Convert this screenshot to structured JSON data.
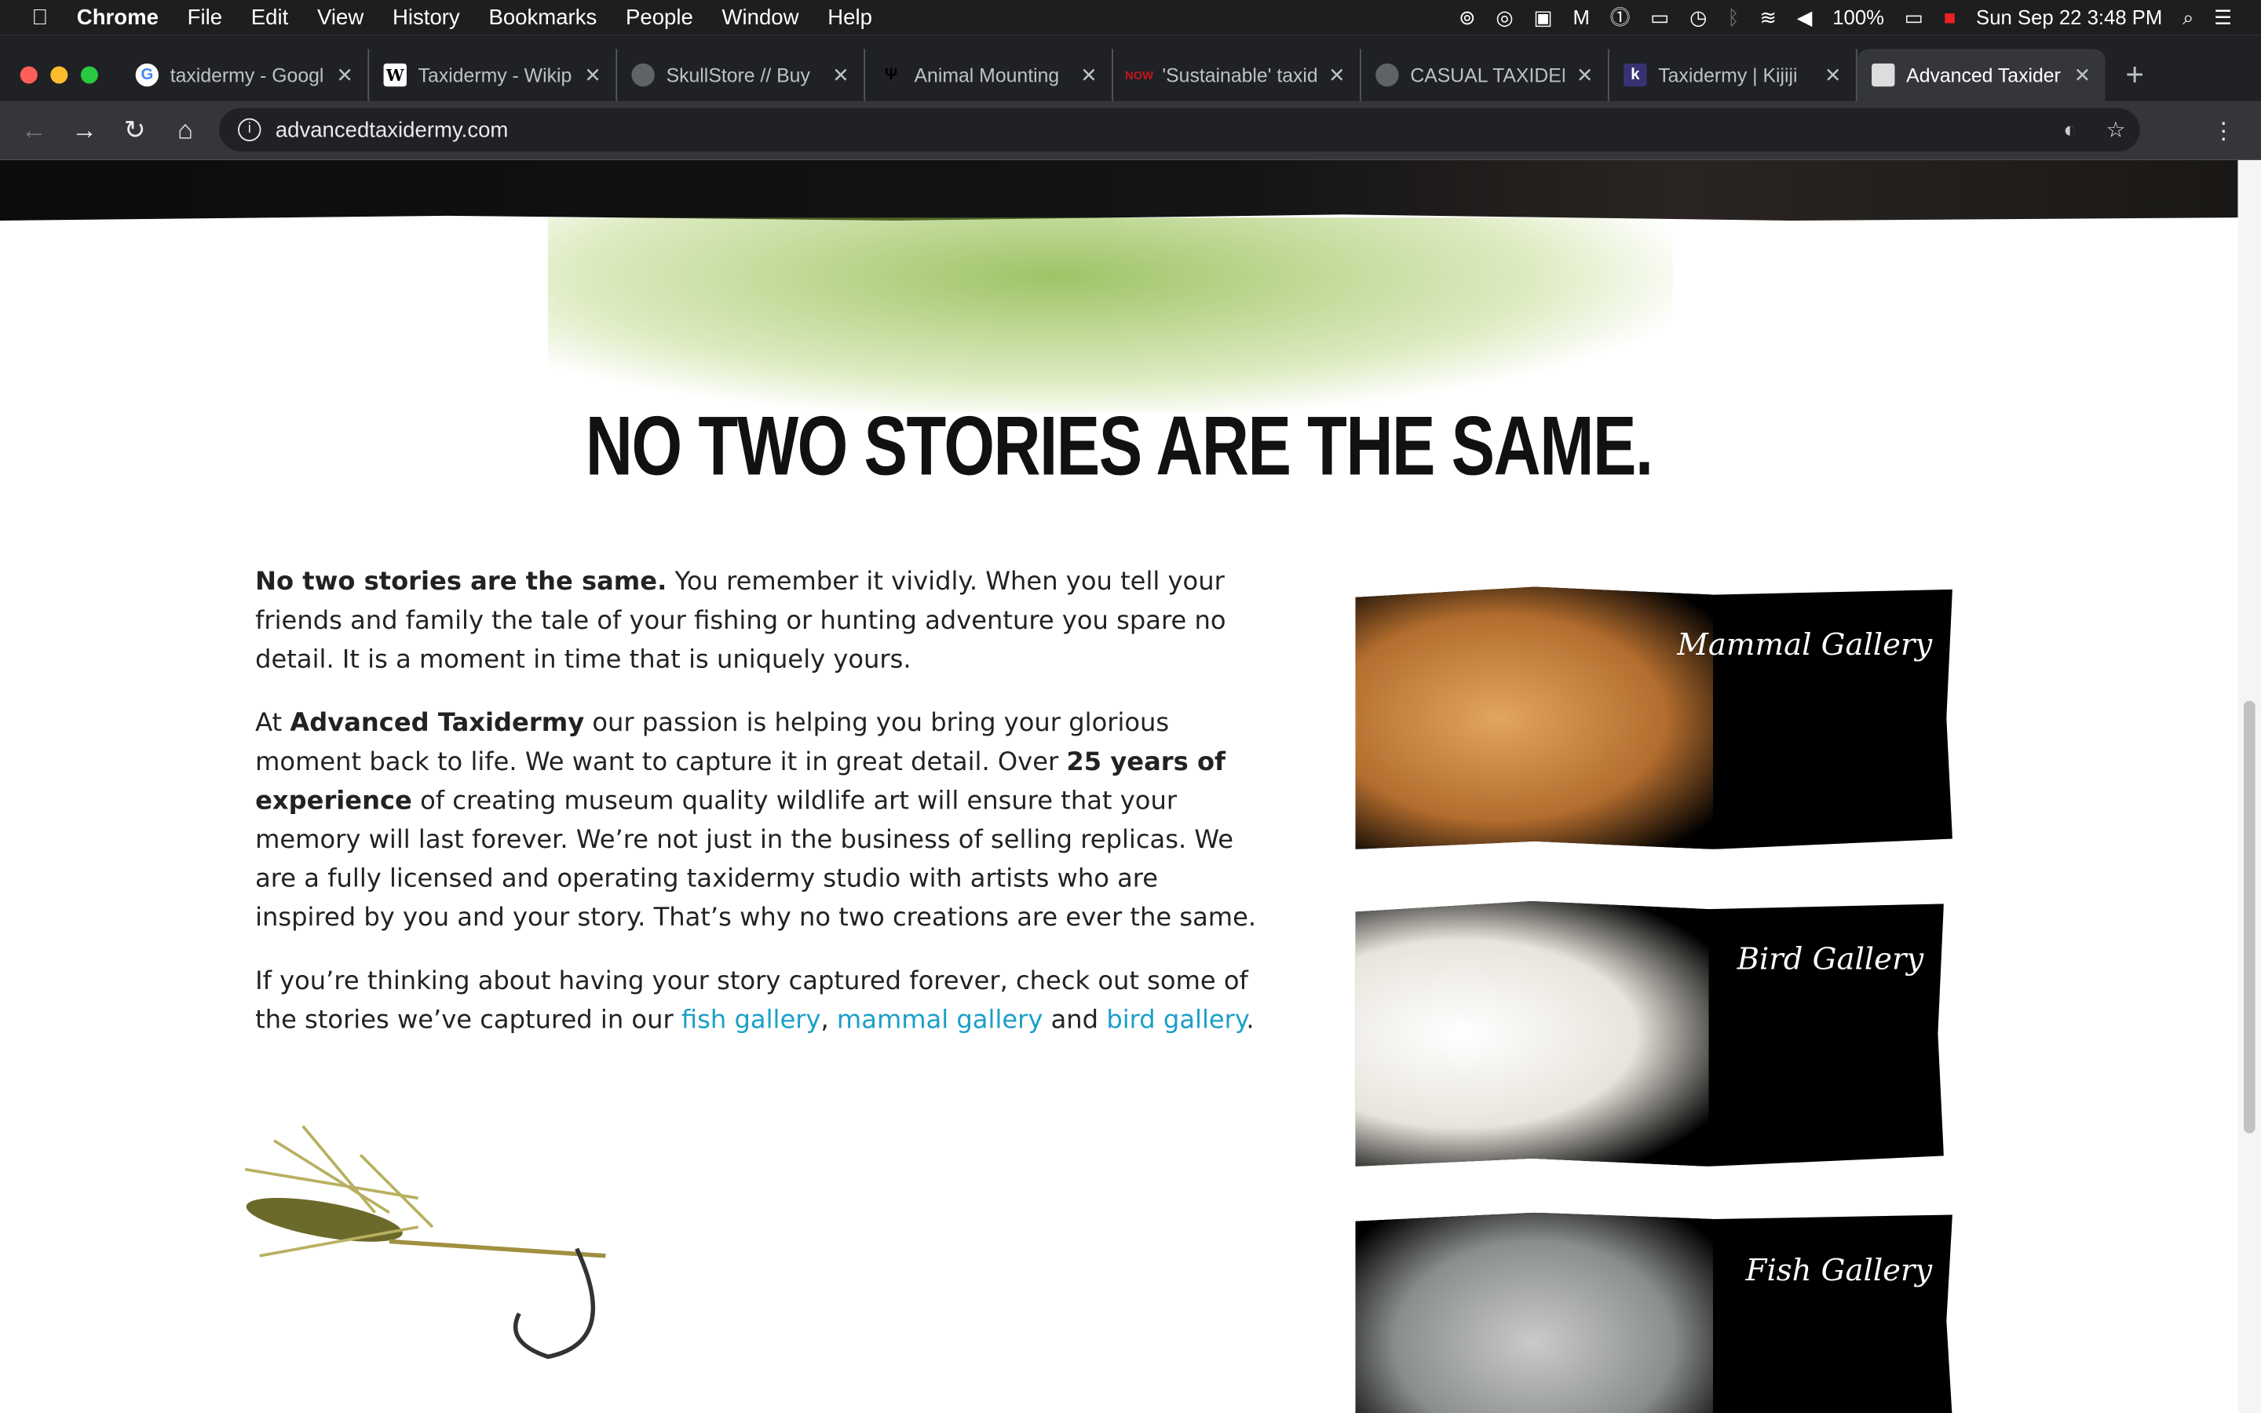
{
  "menubar": {
    "app": "Chrome",
    "items": [
      "File",
      "Edit",
      "View",
      "History",
      "Bookmarks",
      "People",
      "Window",
      "Help"
    ],
    "battery": "100%",
    "datetime": "Sun Sep 22  3:48 PM"
  },
  "tabs": [
    {
      "title": "taxidermy - Google",
      "favicon": "G",
      "color": "#ffffff"
    },
    {
      "title": "Taxidermy - Wikipedia",
      "favicon": "W",
      "color": "#ffffff"
    },
    {
      "title": "SkullStore // Buy",
      "favicon": "globe",
      "color": "#5f6368"
    },
    {
      "title": "Animal Mounting",
      "favicon": "deer",
      "color": "#000000"
    },
    {
      "title": "'Sustainable' taxidermy",
      "favicon": "NOW",
      "color": "#c4161c"
    },
    {
      "title": "CASUAL TAXIDERMY",
      "favicon": "globe",
      "color": "#5f6368"
    },
    {
      "title": "Taxidermy | Kijiji",
      "favicon": "k",
      "color": "#373373"
    },
    {
      "title": "Advanced Taxidermy",
      "favicon": "logo",
      "color": "#ffffff",
      "active": true
    }
  ],
  "address": {
    "url": "advancedtaxidermy.com"
  },
  "page": {
    "heading": "NO TWO STORIES ARE THE SAME.",
    "p1_bold": "No two stories are the same.",
    "p1": " You remember it vividly. When you tell your friends and family the tale of your fishing or hunting adventure you spare no detail. It is a moment in time that is uniquely yours.",
    "p2_a": "At ",
    "p2_b": "Advanced Taxidermy",
    "p2_c": " our passion is helping you bring your glorious moment back to life. We want to capture it in great detail. Over ",
    "p2_d": "25 years of experience",
    "p2_e": " of creating museum quality wildlife art will ensure that your memory will last forever. We’re not just in the business of selling replicas. We are a fully licensed and operating taxidermy studio with artists who are inspired by you and your story. That’s why no two creations are ever the same.",
    "p3_a": "If you’re thinking about having your story captured forever, check out some of the stories we’ve captured in our ",
    "fish_link": "fish gallery",
    "sep": ", ",
    "mammal_link": "mammal gallery",
    "and": " and ",
    "bird_link": "bird gallery",
    "end": ".",
    "galleries": [
      {
        "caption": "Mammal Gallery"
      },
      {
        "caption": "Bird Gallery"
      },
      {
        "caption": "Fish Gallery"
      }
    ],
    "link_color": "#1a9fc8"
  }
}
